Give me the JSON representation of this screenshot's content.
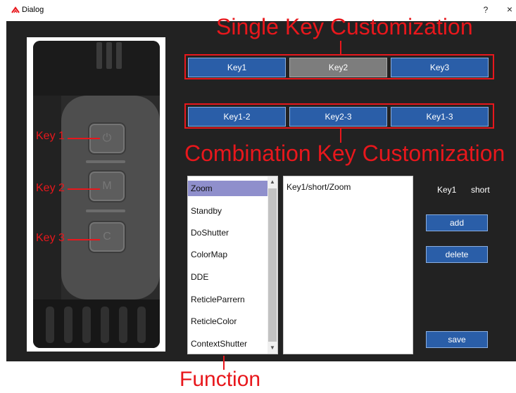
{
  "window": {
    "title": "Dialog",
    "help_label": "?",
    "close_label": "×"
  },
  "annotations": {
    "single_key": "Single Key Customization",
    "combination_key": "Combination Key Customization",
    "function": "Function",
    "device_keys": [
      "Key 1",
      "Key 2",
      "Key 3"
    ]
  },
  "device": {
    "key_glyphs": [
      "⏻",
      "M",
      "C"
    ]
  },
  "single_keys": [
    {
      "label": "Key1",
      "selected": false
    },
    {
      "label": "Key2",
      "selected": true
    },
    {
      "label": "Key3",
      "selected": false
    }
  ],
  "combination_keys": [
    {
      "label": "Key1-2"
    },
    {
      "label": "Key2-3"
    },
    {
      "label": "Key1-3"
    }
  ],
  "functions": {
    "items": [
      "Zoom",
      "Standby",
      "DoShutter",
      "ColorMap",
      "DDE",
      "ReticleParrern",
      "ReticleColor",
      "ContextShutter"
    ],
    "selected": "Zoom"
  },
  "assignments": [
    "Key1/short/Zoom"
  ],
  "current": {
    "key": "Key1",
    "press": "short"
  },
  "actions": {
    "add": "add",
    "delete": "delete",
    "save": "save"
  },
  "colors": {
    "annotation_red": "#e8171c",
    "button_blue": "#2a5ea8",
    "selected_gray": "#7d7d7d",
    "list_selection": "#8f8fcc",
    "background": "#222222"
  }
}
